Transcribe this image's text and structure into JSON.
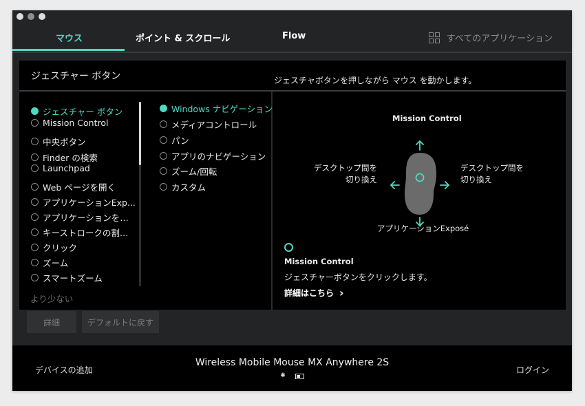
{
  "tabs": [
    {
      "label": "マウス",
      "active": true
    },
    {
      "label": "ポイント & スクロール",
      "active": false
    },
    {
      "label": "Flow",
      "active": false
    }
  ],
  "all_apps": {
    "label": "すべてのアプリケーション",
    "icon": "grid-icon"
  },
  "panel": {
    "title": "ジェスチャー ボタン",
    "description": "ジェスチャボタンを押しながら マウス を動かします。"
  },
  "button_list": {
    "items": [
      {
        "label": "ジェスチャー ボタン",
        "selected": true
      },
      {
        "label": "Mission Control",
        "selected": false
      },
      {
        "label": "中央ボタン",
        "selected": false
      },
      {
        "label": "Finder の検索",
        "selected": false
      },
      {
        "label": "Launchpad",
        "selected": false
      },
      {
        "label": "Web ページを開く",
        "selected": false
      },
      {
        "label": "アプリケーションExp...",
        "selected": false
      },
      {
        "label": "アプリケーションを…",
        "selected": false
      },
      {
        "label": "キーストロークの割…",
        "selected": false
      },
      {
        "label": "クリック",
        "selected": false
      },
      {
        "label": "ズーム",
        "selected": false
      },
      {
        "label": "スマートズーム",
        "selected": false
      }
    ],
    "less_label": "より少ない"
  },
  "gesture_list": {
    "items": [
      {
        "label": "Windows ナビゲーション",
        "selected": true
      },
      {
        "label": "メディアコントロール",
        "selected": false
      },
      {
        "label": "パン",
        "selected": false
      },
      {
        "label": "アプリのナビゲーション",
        "selected": false
      },
      {
        "label": "ズーム/回転",
        "selected": false
      },
      {
        "label": "カスタム",
        "selected": false
      }
    ]
  },
  "diagram": {
    "up": "Mission Control",
    "down": "アプリケーションExposé",
    "left_line1": "デスクトップ間を",
    "left_line2": "切り換え",
    "right_line1": "デスクトップ間を",
    "right_line2": "切り換え"
  },
  "detail": {
    "name": "Mission Control",
    "description": "ジェスチャーボタンをクリックします。",
    "link": "詳細はこちら",
    "link_icon": "›"
  },
  "buttons": {
    "details": "詳細",
    "reset": "デフォルトに戻す"
  },
  "footer": {
    "add_device": "デバイスの追加",
    "device_name": "Wireless Mobile Mouse MX Anywhere 2S",
    "bluetooth_icon": "✱",
    "battery_icon": "▭",
    "login": "ログイン"
  },
  "colors": {
    "accent": "#4fd8c3",
    "window_bg": "#232426",
    "panel_bg": "#000000"
  }
}
